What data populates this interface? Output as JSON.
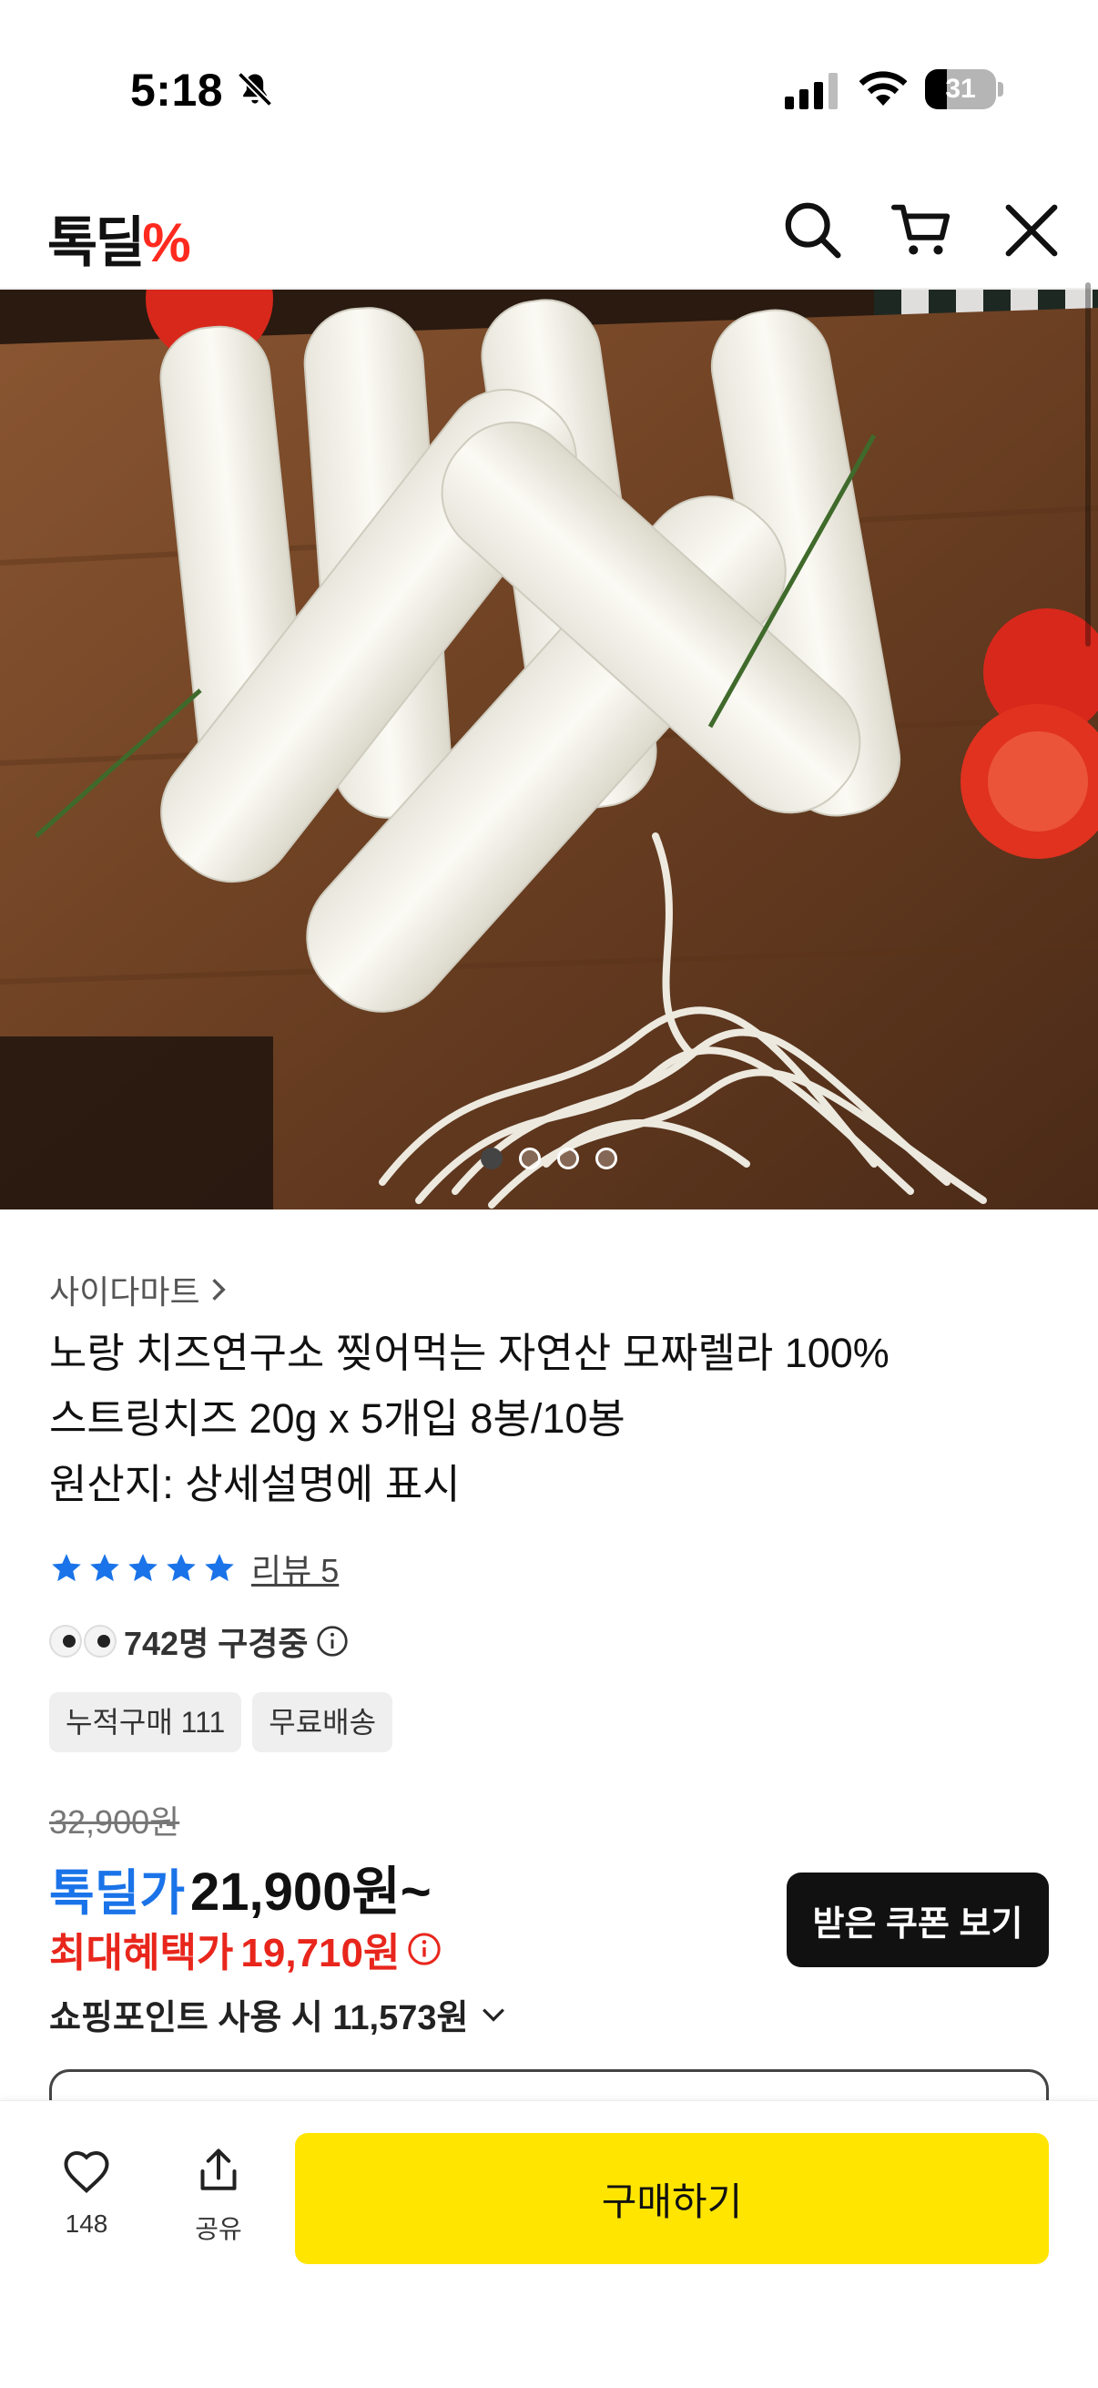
{
  "status_bar": {
    "time": "5:18",
    "battery": "31",
    "battery_level": 0.31
  },
  "header": {
    "logo": "톡딜",
    "logo_mark": "%",
    "icons": [
      "search-icon",
      "cart-icon",
      "close-icon"
    ]
  },
  "gallery": {
    "image_count": 4,
    "active_index": 0
  },
  "product": {
    "seller": "사이다마트",
    "title_lines": [
      "노랑 치즈연구소 찢어먹는 자연산 모짜렐라 100%",
      "스트링치즈 20g x 5개입 8봉/10봉",
      "원산지: 상세설명에 표시"
    ],
    "rating": 5,
    "review_label": "리뷰 5",
    "viewing": "742명 구경중",
    "chips": [
      "누적구매 111",
      "무료배송"
    ],
    "original_price": "32,900원",
    "deal_label": "톡딜가",
    "deal_price": "21,900원~",
    "max_label": "최대혜택가",
    "max_price": "19,710원",
    "coupon_button": "받은 쿠폰 보기",
    "points": "쇼핑포인트 사용 시 11,573원"
  },
  "bottom_bar": {
    "like_count": "148",
    "share_label": "공유",
    "buy_label": "구매하기"
  },
  "colors": {
    "accent_blue": "#1a73e8",
    "benefit_red": "#e8261c",
    "buy_yellow": "#ffe500",
    "logo_red": "#ff2a1f"
  }
}
